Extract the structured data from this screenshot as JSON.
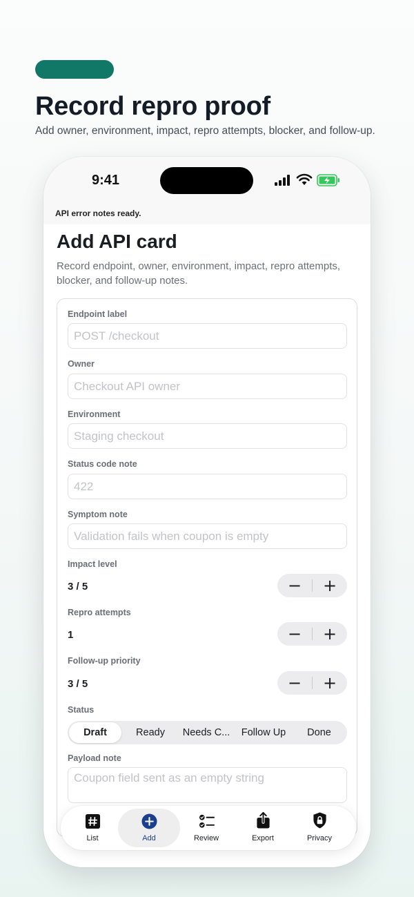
{
  "hero": {
    "title": "Record repro proof",
    "subtitle": "Add owner, environment, impact, repro attempts, blocker, and follow-up."
  },
  "status_bar": {
    "time": "9:41"
  },
  "notice": "API error notes ready.",
  "page": {
    "title": "Add API card",
    "description": "Record endpoint, owner, environment, impact, repro attempts, blocker, and follow-up notes."
  },
  "form": {
    "endpoint": {
      "label": "Endpoint label",
      "placeholder": "POST /checkout",
      "value": ""
    },
    "owner": {
      "label": "Owner",
      "placeholder": "Checkout API owner",
      "value": ""
    },
    "environment": {
      "label": "Environment",
      "placeholder": "Staging checkout",
      "value": ""
    },
    "status_code": {
      "label": "Status code note",
      "placeholder": "422",
      "value": ""
    },
    "symptom": {
      "label": "Symptom note",
      "placeholder": "Validation fails when coupon is empty",
      "value": ""
    },
    "impact": {
      "label": "Impact level",
      "value": "3 / 5"
    },
    "repro": {
      "label": "Repro attempts",
      "value": "1"
    },
    "priority": {
      "label": "Follow-up priority",
      "value": "3 / 5"
    },
    "status": {
      "label": "Status",
      "options": [
        "Draft",
        "Ready",
        "Needs C...",
        "Follow Up",
        "Done"
      ],
      "selected": "Draft"
    },
    "payload": {
      "label": "Payload note",
      "placeholder": "Coupon field sent as an empty string",
      "value": ""
    }
  },
  "stepper": {
    "minus": "−",
    "plus": "+"
  },
  "tabs": [
    {
      "label": "List",
      "icon": "hash-icon"
    },
    {
      "label": "Add",
      "icon": "plus-circle-icon",
      "active": true
    },
    {
      "label": "Review",
      "icon": "checklist-icon"
    },
    {
      "label": "Export",
      "icon": "share-icon"
    },
    {
      "label": "Privacy",
      "icon": "lock-shield-icon"
    }
  ],
  "colors": {
    "accent": "#117868",
    "tab_active": "#1a3f8c",
    "battery": "#34c759"
  }
}
